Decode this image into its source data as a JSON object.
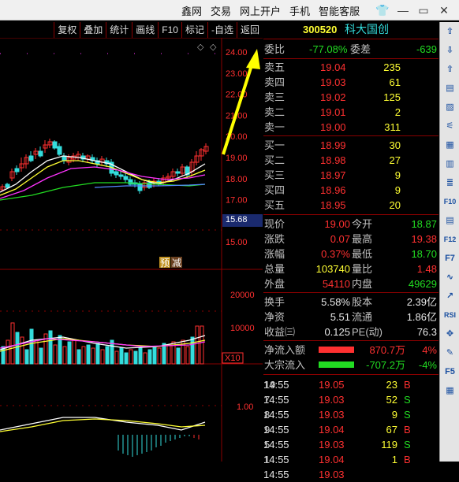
{
  "menu": [
    "鑫网",
    "交易",
    "网上开户",
    "手机",
    "智能客服"
  ],
  "toolbar": [
    "复权",
    "叠加",
    "统计",
    "画线",
    "F10",
    "标记",
    "-自选",
    "返回"
  ],
  "stock": {
    "code": "300520",
    "name": "科大国创"
  },
  "weibi": {
    "l1": "委比",
    "v1": "-77.08%",
    "l2": "委差",
    "v2": "-639"
  },
  "asks": [
    {
      "label": "卖五",
      "price": "19.04",
      "vol": "235"
    },
    {
      "label": "卖四",
      "price": "19.03",
      "vol": "61"
    },
    {
      "label": "卖三",
      "price": "19.02",
      "vol": "125"
    },
    {
      "label": "卖二",
      "price": "19.01",
      "vol": "2"
    },
    {
      "label": "卖一",
      "price": "19.00",
      "vol": "311"
    }
  ],
  "bids": [
    {
      "label": "买一",
      "price": "18.99",
      "vol": "30"
    },
    {
      "label": "买二",
      "price": "18.98",
      "vol": "27"
    },
    {
      "label": "买三",
      "price": "18.97",
      "vol": "9"
    },
    {
      "label": "买四",
      "price": "18.96",
      "vol": "9"
    },
    {
      "label": "买五",
      "price": "18.95",
      "vol": "20"
    }
  ],
  "stats": [
    {
      "l1": "现价",
      "v1": "19.00",
      "c1": "red",
      "l2": "今开",
      "v2": "18.87",
      "c2": "grn"
    },
    {
      "l1": "涨跌",
      "v1": "0.07",
      "c1": "red",
      "l2": "最高",
      "v2": "19.38",
      "c2": "red"
    },
    {
      "l1": "涨幅",
      "v1": "0.37%",
      "c1": "red",
      "l2": "最低",
      "v2": "18.70",
      "c2": "grn"
    },
    {
      "l1": "总量",
      "v1": "103740",
      "c1": "yel",
      "l2": "量比",
      "v2": "1.48",
      "c2": "red"
    },
    {
      "l1": "外盘",
      "v1": "54110",
      "c1": "red",
      "l2": "内盘",
      "v2": "49629",
      "c2": "grn"
    }
  ],
  "stats2": [
    {
      "l1": "换手",
      "v1": "5.58%",
      "l2": "股本",
      "v2": "2.39亿"
    },
    {
      "l1": "净资",
      "v1": "5.51",
      "l2": "流通",
      "v2": "1.86亿"
    },
    {
      "l1": "收益㈢",
      "v1": "0.125",
      "l2": "PE(动)",
      "v2": "76.3"
    }
  ],
  "flows": [
    {
      "label": "净流入额",
      "value": "870.7万",
      "pct": "4%",
      "color": "red",
      "bar": 0.7
    },
    {
      "label": "大宗流入",
      "value": "-707.2万",
      "pct": "-4%",
      "color": "grn",
      "bar": 0.7
    }
  ],
  "ticks": [
    {
      "time": "14:55",
      "price": "19.05",
      "vol": "23",
      "side": "B",
      "n": "19"
    },
    {
      "time": "14:55",
      "price": "19.03",
      "vol": "52",
      "side": "S",
      "n": "7"
    },
    {
      "time": "14:55",
      "price": "19.03",
      "vol": "9",
      "side": "S",
      "n": "8"
    },
    {
      "time": "14:55",
      "price": "19.04",
      "vol": "67",
      "side": "B",
      "n": "9"
    },
    {
      "time": "14:55",
      "price": "19.03",
      "vol": "119",
      "side": "S",
      "n": "5"
    },
    {
      "time": "14:55",
      "price": "19.04",
      "vol": "1",
      "side": "B",
      "n": "1"
    },
    {
      "time": "14:55",
      "price": "19.03",
      "vol": "",
      "side": "",
      "n": ""
    }
  ],
  "axis": {
    "price": [
      "24.00",
      "23.00",
      "22.00",
      "21.00",
      "20.00",
      "19.00",
      "18.00",
      "17.00",
      "15.68",
      "15.00"
    ],
    "vol": [
      "20000",
      "10000",
      "X10"
    ],
    "macd": [
      "1.00"
    ]
  },
  "badges": {
    "yu": "预",
    "jian": "减"
  },
  "colors": {
    "up": "#ff3030",
    "down": "#22dd22",
    "grid": "#8a0000"
  }
}
